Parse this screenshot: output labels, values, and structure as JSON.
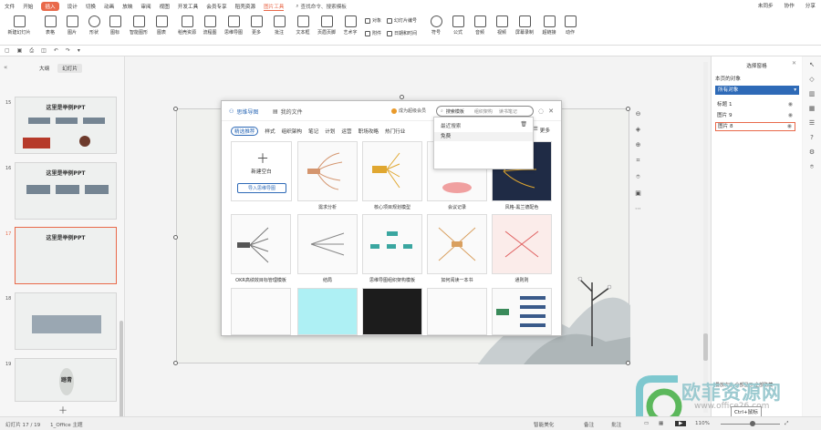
{
  "menubar": {
    "file": "文件",
    "items": [
      "开始",
      "插入",
      "设计",
      "切换",
      "动画",
      "放映",
      "审阅",
      "视图",
      "开发工具",
      "会员专享",
      "稻壳资源"
    ],
    "picture_tool": "图片工具",
    "search_label": "查找命令、搜索模板",
    "right": [
      "未同步",
      "协作",
      "分享"
    ]
  },
  "ribbon": {
    "new_slide": "新建幻灯片",
    "table": "表格",
    "picture": "图片",
    "shape": "形状",
    "icons": "图标",
    "smart_graphic": "智能图形",
    "chart": "图表",
    "dockit": "稻壳资源",
    "flowchart": "流程图",
    "mindmap": "思维导图",
    "more": "更多",
    "comment": "批注",
    "textbox": "文本框",
    "header_footer": "页眉页脚",
    "art_text": "艺术字",
    "object": "对象",
    "slide_number": "幻灯片编号",
    "attachment": "附件",
    "date_time": "日期和时间",
    "symbol": "符号",
    "formula": "公式",
    "audio": "音频",
    "video": "视频",
    "screen_record": "屏幕录制",
    "hyperlink": "超链接",
    "action": "动作"
  },
  "left_panel": {
    "tabs": [
      "大纲",
      "幻灯片"
    ],
    "slides": [
      {
        "num": "15",
        "title": "这里是举例PPT"
      },
      {
        "num": "16",
        "title": "这里是举例PPT"
      },
      {
        "num": "17",
        "title": "这里是举例PPT"
      },
      {
        "num": "18",
        "title": ""
      },
      {
        "num": "19",
        "title": "踏青"
      }
    ]
  },
  "dialog": {
    "title": "思维导图",
    "my_files": "我的文件",
    "vip": "成为超级会员",
    "search_placeholder": "搜索模板",
    "search_hints": [
      "组织架构",
      "读书笔记"
    ],
    "categories": [
      "精选推荐",
      "样式",
      "组织架构",
      "笔记",
      "计划",
      "运营",
      "职场攻略",
      "热门行业"
    ],
    "more": "更多",
    "create_label": "新建空白",
    "import_label": "导入思维导图",
    "row1_captions": [
      "需求分析",
      "核心项目规划模型",
      "会议记录",
      "风格-黑兰德配色"
    ],
    "row2_captions": [
      "OKR高绩效目标管理模板",
      "结局",
      "思维导图组织架构模板",
      "如何阅读一本书",
      "通则则"
    ]
  },
  "dropdown": {
    "header": "最近搜索",
    "item": "免费"
  },
  "selection_pane": {
    "title": "选择窗格",
    "sub": "本页的对象",
    "filter": "所有对象",
    "objects": [
      "标题 1",
      "图片 9",
      "图片 8"
    ],
    "bottom": "叠放次序  全部显示  全部隐藏"
  },
  "status": {
    "slide_info": "幻灯片 17 / 19",
    "theme": "1_Office 主题",
    "beautify": "智能美化",
    "notes": "备注",
    "comments": "批注",
    "zoom": "110%"
  },
  "watermark": {
    "text": "欧菲资源网",
    "url": "www.office26.com"
  },
  "tooltip": "Ctrl+鼠标"
}
